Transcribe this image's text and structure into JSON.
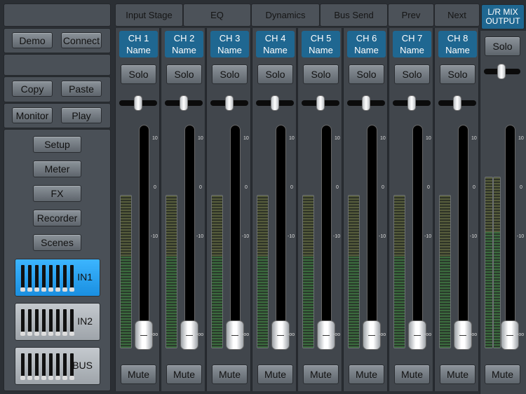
{
  "left": {
    "demo": "Demo",
    "connect": "Connect",
    "copy": "Copy",
    "paste": "Paste",
    "monitor": "Monitor",
    "play": "Play",
    "menu": [
      "Setup",
      "Meter",
      "FX",
      "Recorder",
      "Scenes"
    ],
    "banks": [
      {
        "label": "IN1",
        "active": true
      },
      {
        "label": "IN2",
        "active": false
      },
      {
        "label": "BUS",
        "active": false
      }
    ]
  },
  "tabs": [
    "Input Stage",
    "EQ",
    "Dynamics",
    "Bus Send",
    "Prev",
    "Next"
  ],
  "channels": [
    {
      "line1": "CH 1",
      "line2": "Name"
    },
    {
      "line1": "CH 2",
      "line2": "Name"
    },
    {
      "line1": "CH 3",
      "line2": "Name"
    },
    {
      "line1": "CH 4",
      "line2": "Name"
    },
    {
      "line1": "CH 5",
      "line2": "Name"
    },
    {
      "line1": "CH 6",
      "line2": "Name"
    },
    {
      "line1": "CH 7",
      "line2": "Name"
    },
    {
      "line1": "CH 8",
      "line2": "Name"
    }
  ],
  "solo": "Solo",
  "mute": "Mute",
  "scale": [
    "10",
    "0",
    "-10",
    "-oo"
  ],
  "master": {
    "line1": "L/R MIX",
    "line2": "OUTPUT"
  },
  "colors": {
    "accent": "#1f6791",
    "bank_active": "#2aa3f5"
  }
}
